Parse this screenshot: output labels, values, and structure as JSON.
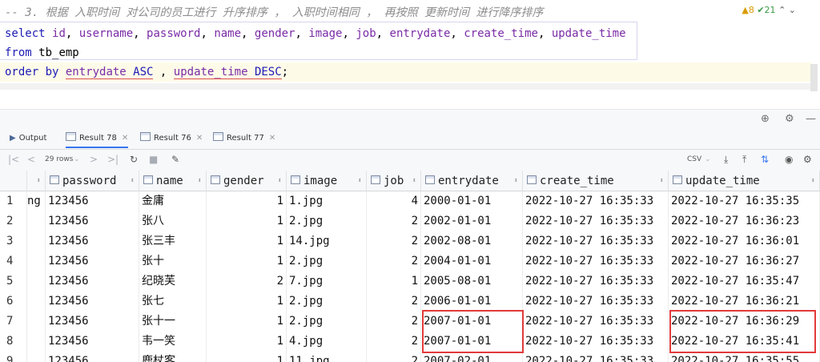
{
  "editor": {
    "comment": "-- 3. 根据 入职时间 对公司的员工进行 升序排序 ， 入职时间相同 ， 再按照 更新时间 进行降序排序",
    "line2_kw": "select",
    "line2_cols": [
      "id",
      "username",
      "password",
      "name",
      "gender",
      "image",
      "job",
      "entrydate",
      "create_time",
      "update_time"
    ],
    "line3_kw": "from",
    "line3_table": "tb_emp",
    "line4_kw1": "order by",
    "line4_col1": "entrydate",
    "line4_dir1": "ASC",
    "line4_sep": ",",
    "line4_col2": "update_time",
    "line4_dir2": "DESC",
    "line4_end": ";",
    "warnings": "▲8",
    "checks": "✔21"
  },
  "tabs": [
    {
      "label": "Output"
    },
    {
      "label": "Result 78"
    },
    {
      "label": "Result 76"
    },
    {
      "label": "Result 77"
    }
  ],
  "toolbar": {
    "rows": "29 rows",
    "export": "CSV"
  },
  "columns": [
    "password",
    "name",
    "gender",
    "image",
    "job",
    "entrydate",
    "create_time",
    "update_time"
  ],
  "partial_username": [
    "ng",
    "",
    "",
    "",
    "",
    "",
    "",
    "",
    ""
  ],
  "rows": [
    {
      "n": "1",
      "password": "123456",
      "name": "金庸",
      "gender": "1",
      "image": "1.jpg",
      "job": "4",
      "entrydate": "2000-01-01",
      "create_time": "2022-10-27 16:35:33",
      "update_time": "2022-10-27 16:35:35"
    },
    {
      "n": "2",
      "password": "123456",
      "name": "张八",
      "gender": "1",
      "image": "2.jpg",
      "job": "2",
      "entrydate": "2002-01-01",
      "create_time": "2022-10-27 16:35:33",
      "update_time": "2022-10-27 16:36:23"
    },
    {
      "n": "3",
      "password": "123456",
      "name": "张三丰",
      "gender": "1",
      "image": "14.jpg",
      "job": "2",
      "entrydate": "2002-08-01",
      "create_time": "2022-10-27 16:35:33",
      "update_time": "2022-10-27 16:36:01"
    },
    {
      "n": "4",
      "password": "123456",
      "name": "张十",
      "gender": "1",
      "image": "2.jpg",
      "job": "2",
      "entrydate": "2004-01-01",
      "create_time": "2022-10-27 16:35:33",
      "update_time": "2022-10-27 16:36:27"
    },
    {
      "n": "5",
      "password": "123456",
      "name": "纪晓芙",
      "gender": "2",
      "image": "7.jpg",
      "job": "1",
      "entrydate": "2005-08-01",
      "create_time": "2022-10-27 16:35:33",
      "update_time": "2022-10-27 16:35:47"
    },
    {
      "n": "6",
      "password": "123456",
      "name": "张七",
      "gender": "1",
      "image": "2.jpg",
      "job": "2",
      "entrydate": "2006-01-01",
      "create_time": "2022-10-27 16:35:33",
      "update_time": "2022-10-27 16:36:21"
    },
    {
      "n": "7",
      "password": "123456",
      "name": "张十一",
      "gender": "1",
      "image": "2.jpg",
      "job": "2",
      "entrydate": "2007-01-01",
      "create_time": "2022-10-27 16:35:33",
      "update_time": "2022-10-27 16:36:29"
    },
    {
      "n": "8",
      "password": "123456",
      "name": "韦一笑",
      "gender": "1",
      "image": "4.jpg",
      "job": "2",
      "entrydate": "2007-01-01",
      "create_time": "2022-10-27 16:35:33",
      "update_time": "2022-10-27 16:35:41"
    },
    {
      "n": "9",
      "password": "123456",
      "name": "鹿杖客",
      "gender": "1",
      "image": "11.jpg",
      "job": "2",
      "entrydate": "2007-02-01",
      "create_time": "2022-10-27 16:35:33",
      "update_time": "2022-10-27 16:35:55"
    }
  ]
}
